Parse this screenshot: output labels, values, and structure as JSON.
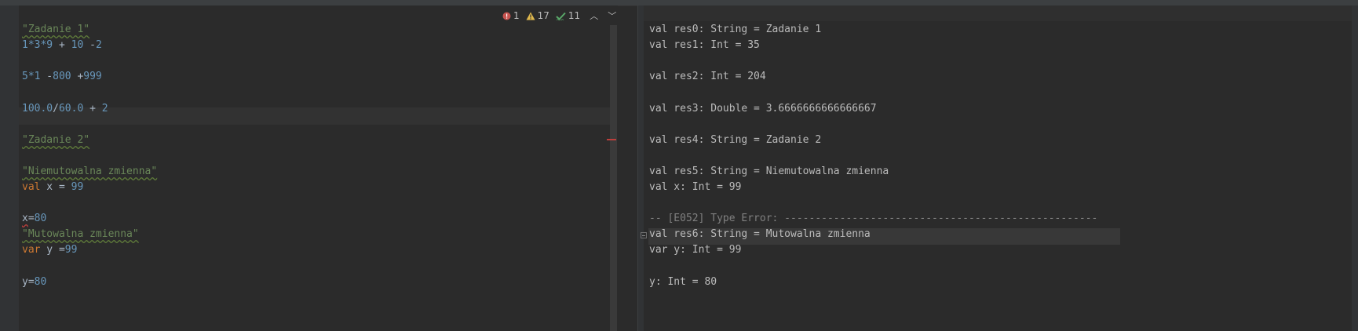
{
  "inspections": {
    "errors": "1",
    "warnings": "17",
    "typos": "11"
  },
  "editor": {
    "lines": [
      {
        "id": "l1",
        "tokens": [
          {
            "t": "\"Zadanie 1\"",
            "c": "str",
            "w": true
          }
        ]
      },
      {
        "id": "l2",
        "tokens": [
          {
            "t": "1*3*9",
            "c": "num"
          },
          {
            "t": " + ",
            "c": "plain"
          },
          {
            "t": "10",
            "c": "num"
          },
          {
            "t": " -",
            "c": "plain"
          },
          {
            "t": "2",
            "c": "num"
          }
        ]
      },
      {
        "id": "l3",
        "tokens": []
      },
      {
        "id": "l4",
        "tokens": [
          {
            "t": "5*1",
            "c": "num"
          },
          {
            "t": " -",
            "c": "plain"
          },
          {
            "t": "800",
            "c": "num"
          },
          {
            "t": " +",
            "c": "plain"
          },
          {
            "t": "999",
            "c": "num"
          }
        ]
      },
      {
        "id": "l5",
        "tokens": []
      },
      {
        "id": "l6",
        "tokens": [
          {
            "t": "100.0",
            "c": "num"
          },
          {
            "t": "/",
            "c": "plain"
          },
          {
            "t": "60.0",
            "c": "num"
          },
          {
            "t": " + ",
            "c": "plain"
          },
          {
            "t": "2",
            "c": "num"
          }
        ]
      },
      {
        "id": "l7",
        "tokens": []
      },
      {
        "id": "l8",
        "tokens": [
          {
            "t": "\"Zadanie 2\"",
            "c": "str",
            "w": true
          }
        ]
      },
      {
        "id": "l9",
        "tokens": []
      },
      {
        "id": "l10",
        "tokens": [
          {
            "t": "\"Niemutowalna zmienna\"",
            "c": "str",
            "w": true
          }
        ]
      },
      {
        "id": "l11",
        "tokens": [
          {
            "t": "val",
            "c": "kw"
          },
          {
            "t": " x = ",
            "c": "plain"
          },
          {
            "t": "99",
            "c": "num"
          }
        ]
      },
      {
        "id": "l12",
        "tokens": []
      },
      {
        "id": "l13",
        "tokens": [
          {
            "t": "x",
            "c": "plain",
            "r": true
          },
          {
            "t": "=",
            "c": "plain"
          },
          {
            "t": "80",
            "c": "num"
          }
        ]
      },
      {
        "id": "l14",
        "tokens": [
          {
            "t": "\"Mutowalna zmienna\"",
            "c": "str",
            "w": true
          }
        ]
      },
      {
        "id": "l15",
        "tokens": [
          {
            "t": "var",
            "c": "kw"
          },
          {
            "t": " y =",
            "c": "plain"
          },
          {
            "t": "99",
            "c": "num"
          }
        ]
      },
      {
        "id": "l16",
        "tokens": []
      },
      {
        "id": "l17",
        "tokens": [
          {
            "t": "y",
            "c": "plain"
          },
          {
            "t": "=",
            "c": "plain"
          },
          {
            "t": "80",
            "c": "num"
          }
        ]
      }
    ]
  },
  "output": {
    "lines": [
      "val res0: String = Zadanie 1",
      "val res1: Int = 35",
      "",
      "val res2: Int = 204",
      "",
      "val res3: Double = 3.6666666666666667",
      "",
      "val res4: String = Zadanie 2",
      "",
      "val res5: String = Niemutowalna zmienna",
      "val x: Int = 99",
      "",
      "-- [E052] Type Error: ---------------------------------------------------",
      "val res6: String = Mutowalna zmienna",
      "var y: Int = 99",
      "",
      "y: Int = 80"
    ]
  }
}
